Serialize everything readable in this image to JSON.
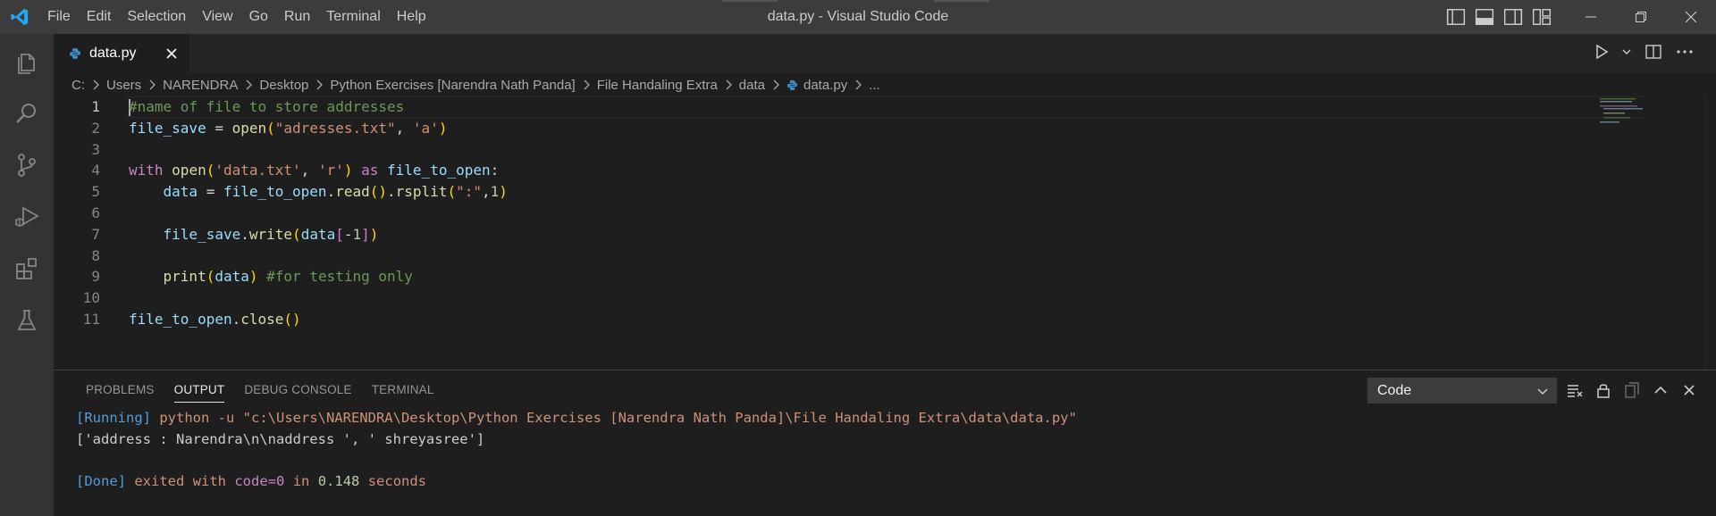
{
  "window": {
    "title": "data.py - Visual Studio Code",
    "menu": [
      "File",
      "Edit",
      "Selection",
      "View",
      "Go",
      "Run",
      "Terminal",
      "Help"
    ]
  },
  "tab": {
    "label": "data.py"
  },
  "breadcrumb": [
    "C:",
    "Users",
    "NARENDRA",
    "Desktop",
    "Python Exercises [Narendra Nath Panda]",
    "File Handaling Extra",
    "data",
    "data.py",
    "..."
  ],
  "editor": {
    "line_numbers": [
      "1",
      "2",
      "3",
      "4",
      "5",
      "6",
      "7",
      "8",
      "9",
      "10",
      "11"
    ],
    "active_line": 1,
    "code": {
      "l1_comment": "#name of file to store addresses",
      "l2_var": "file_save",
      "l2_eq": " = ",
      "l2_fn": "open",
      "l2_open": "(",
      "l2_str1": "\"adresses.txt\"",
      "l2_comma": ", ",
      "l2_str2": "'a'",
      "l2_close": ")",
      "l4_kw": "with",
      "l4_fn": "open",
      "l4_open": "(",
      "l4_str1": "'data.txt'",
      "l4_comma": ", ",
      "l4_str2": "'r'",
      "l4_close": ")",
      "l4_as": "as",
      "l4_var": "file_to_open",
      "l4_colon": ":",
      "l5_indent": "    ",
      "l5_var1": "data",
      "l5_eq": " = ",
      "l5_var2": "file_to_open",
      "l5_dot1": ".",
      "l5_fn1": "read",
      "l5_paren1": "()",
      "l5_dot2": ".",
      "l5_fn2": "rsplit",
      "l5_open": "(",
      "l5_str": "\":\"",
      "l5_comma": ",",
      "l5_num": "1",
      "l5_close": ")",
      "l7_indent": "    ",
      "l7_var": "file_save",
      "l7_dot": ".",
      "l7_fn": "write",
      "l7_open": "(",
      "l7_var2": "data",
      "l7_bopen": "[",
      "l7_minus": "-",
      "l7_num": "1",
      "l7_bclose": "]",
      "l7_close": ")",
      "l9_indent": "    ",
      "l9_fn": "print",
      "l9_open": "(",
      "l9_var": "data",
      "l9_close": ")",
      "l9_comment": "#for testing only",
      "l11_var": "file_to_open",
      "l11_dot": ".",
      "l11_fn": "close",
      "l11_paren": "()"
    }
  },
  "panel": {
    "tabs": [
      "PROBLEMS",
      "OUTPUT",
      "DEBUG CONSOLE",
      "TERMINAL"
    ],
    "active_tab": "OUTPUT",
    "channel_select": "Code",
    "output": {
      "running_tag": "[Running]",
      "running_cmd": "python -u \"c:\\Users\\NARENDRA\\Desktop\\Python Exercises [Narendra Nath Panda]\\File Handaling Extra\\data\\data.py\"",
      "result": "['address : Narendra\\n\\naddress ', ' shreyasree']",
      "done_tag": "[Done]",
      "done_text1": "exited with",
      "done_code": "code=0",
      "done_in": "in",
      "done_time": "0.148",
      "done_seconds": "seconds"
    }
  },
  "colors": {
    "accent": "#007acc",
    "titlebar": "#3c3c3c",
    "activitybar": "#333333",
    "editor_bg": "#1e1e1e"
  }
}
